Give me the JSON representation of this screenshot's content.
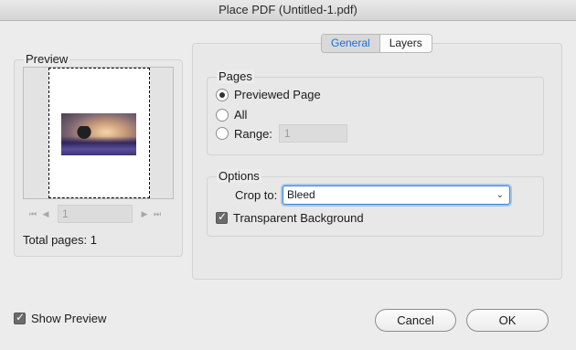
{
  "window": {
    "title": "Place PDF (Untitled-1.pdf)"
  },
  "preview": {
    "legend": "Preview",
    "page_value": "1",
    "total_pages": "Total pages: 1",
    "nav": {
      "first": "⏮",
      "prev": "◀",
      "next": "▶",
      "last": "⏭"
    }
  },
  "tabs": [
    {
      "label": "General",
      "active": true
    },
    {
      "label": "Layers",
      "active": false
    }
  ],
  "pages": {
    "legend": "Pages",
    "options": [
      "Previewed Page",
      "All",
      "Range:"
    ],
    "selected": "Previewed Page",
    "range_value": "1"
  },
  "options": {
    "legend": "Options",
    "crop_label": "Crop to:",
    "crop_value": "Bleed",
    "transparent_bg_label": "Transparent Background",
    "transparent_bg_checked": true
  },
  "footer": {
    "show_preview_label": "Show Preview",
    "show_preview_checked": true,
    "cancel_label": "Cancel",
    "ok_label": "OK"
  },
  "colors": {
    "accent": "#1a6fd6",
    "focus": "#3b86d8"
  }
}
